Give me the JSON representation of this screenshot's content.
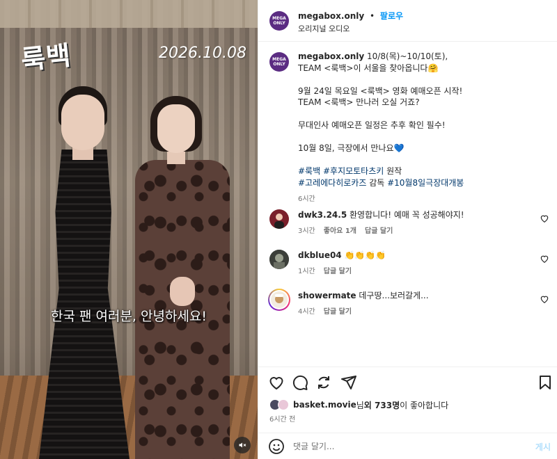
{
  "media": {
    "title_overlay": "룩백",
    "date_overlay": "2026.10.08",
    "subtitle": "한국 팬 여러분, 안녕하세요!",
    "mute_icon": "speaker-muted-icon"
  },
  "header": {
    "avatar_text_top": "MEGA",
    "avatar_text_bottom": "ONLY",
    "username": "megabox.only",
    "separator": "•",
    "follow_label": "팔로우",
    "audio": "오리지널 오디오"
  },
  "caption": {
    "username": "megabox.only",
    "lines": [
      " 10/8(목)~10/10(토),",
      "TEAM <룩백>이 서울을 찾아옵니다🤗",
      "",
      "9월 24일 목요일 <룩백> 영화 예매오픈 시작!",
      "TEAM <룩백> 만나러 오실 거죠?",
      "",
      "무대인사 예매오픈 일정은 추후 확인 필수!",
      "",
      "10월 8일, 극장에서 만나요💙",
      ""
    ],
    "hashtag_line1": {
      "tag1": "#룩백",
      "tag2": "#후지모토타츠키",
      "suffix": " 원작"
    },
    "hashtag_line2": {
      "tag1": "#고레에다히로카즈",
      "mid": " 감독 ",
      "tag2": "#10월8일극장대개봉"
    },
    "time": "6시간"
  },
  "comments": [
    {
      "username": "dwk3.24.5",
      "text": "환영합니다! 예매 꼭 성공해야지!",
      "time": "3시간",
      "likes": "좋아요 1개",
      "reply": "답글 달기",
      "avatar_color": "#7a1f2b"
    },
    {
      "username": "dkblue04",
      "text": "👏👏👏👏",
      "time": "1시간",
      "likes": "",
      "reply": "답글 달기",
      "avatar_color": "#4a4a4a"
    },
    {
      "username": "showermate",
      "text": "데구땅...보러갈게...",
      "time": "4시간",
      "likes": "",
      "reply": "답글 달기",
      "avatar_color": "#d9c07a"
    }
  ],
  "likes": {
    "user": "basket.movie",
    "suffix1": "님 ",
    "bold_part": "외 733명",
    "suffix2": "이 좋아합니다"
  },
  "post_time": "6시간 전",
  "add_comment": {
    "placeholder": "댓글 달기...",
    "post_label": "게시"
  }
}
